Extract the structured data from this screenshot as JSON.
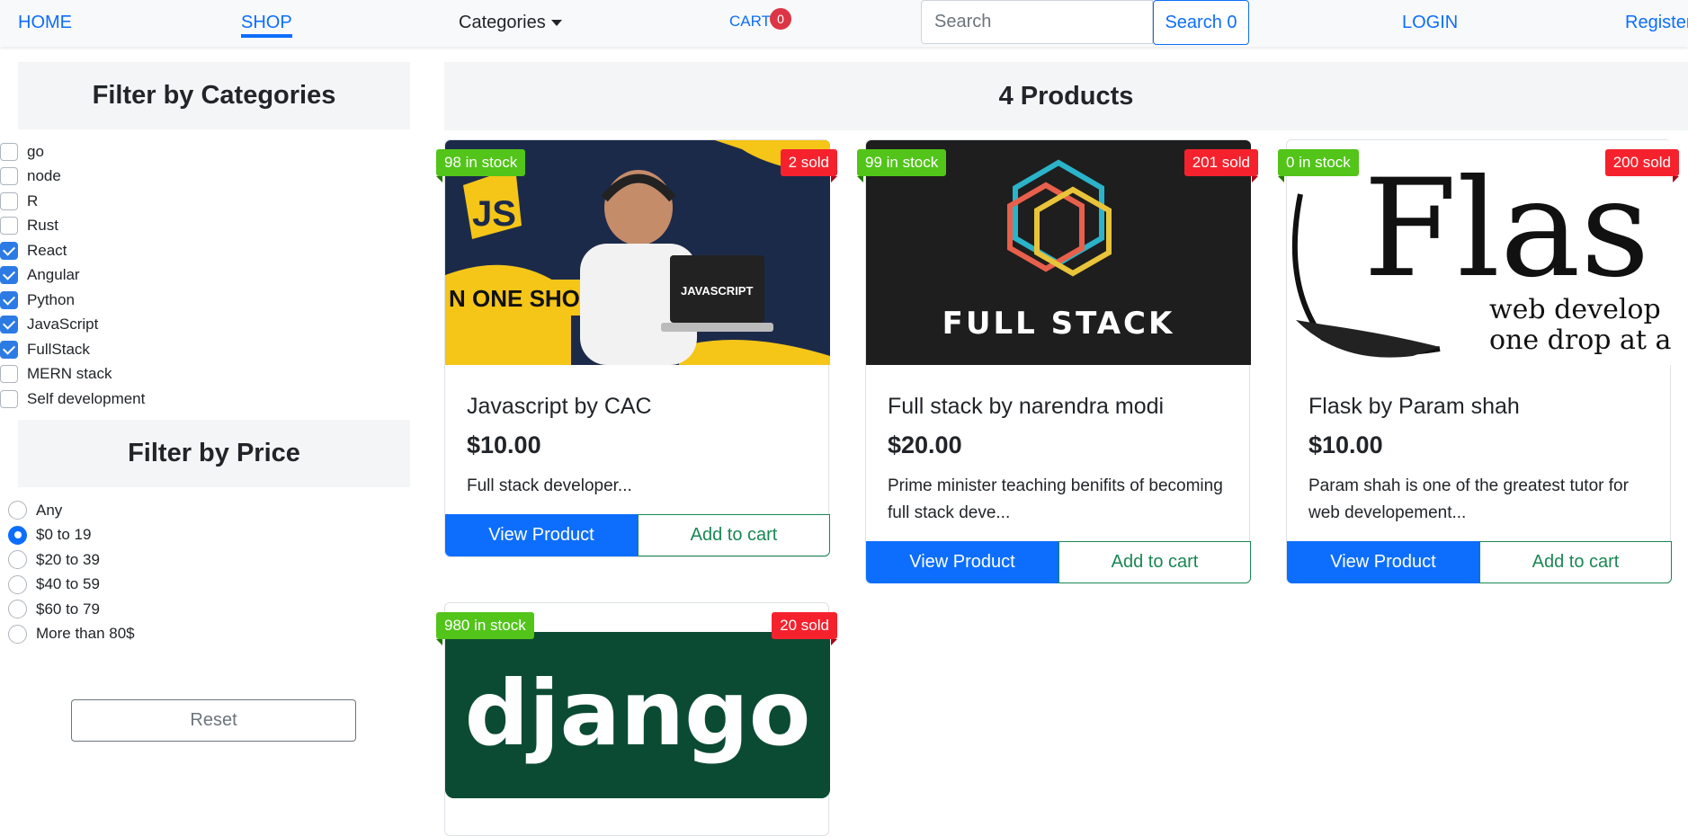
{
  "nav": {
    "home": "HOME",
    "shop": "SHOP",
    "categories": "Categories",
    "cart": "CART",
    "cart_count": "0",
    "search_placeholder": "Search",
    "search_button": "Search 0",
    "login": "LOGIN",
    "register": "Register"
  },
  "sidebar": {
    "category_title": "Filter by Categories",
    "categories": [
      {
        "label": "go",
        "checked": false
      },
      {
        "label": "node",
        "checked": false
      },
      {
        "label": "R",
        "checked": false
      },
      {
        "label": "Rust",
        "checked": false
      },
      {
        "label": "React",
        "checked": true
      },
      {
        "label": "Angular",
        "checked": true
      },
      {
        "label": "Python",
        "checked": true
      },
      {
        "label": "JavaScript",
        "checked": true
      },
      {
        "label": "FullStack",
        "checked": true
      },
      {
        "label": "MERN stack",
        "checked": false
      },
      {
        "label": "Self development",
        "checked": false
      }
    ],
    "price_title": "Filter by Price",
    "prices": [
      {
        "label": "Any",
        "checked": false
      },
      {
        "label": "$0 to 19",
        "checked": true
      },
      {
        "label": "$20 to 39",
        "checked": false
      },
      {
        "label": "$40 to 59",
        "checked": false
      },
      {
        "label": "$60 to 79",
        "checked": false
      },
      {
        "label": "More than 80$",
        "checked": false
      }
    ],
    "reset": "Reset"
  },
  "main": {
    "header": "4 Products",
    "products": [
      {
        "title": "Javascript by CAC",
        "price": "$10.00",
        "desc": "Full stack developer...",
        "stock": "98 in stock",
        "sold": "2 sold",
        "view": "View Product",
        "add": "Add to cart",
        "image_overlay": "N ONE SHOT",
        "image_badge": "JS",
        "laptop_text": "JAVASCRIPT"
      },
      {
        "title": "Full stack by narendra modi",
        "price": "$20.00",
        "desc": "Prime minister teaching benifits of becoming full stack deve...",
        "stock": "99 in stock",
        "sold": "201 sold",
        "view": "View Product",
        "add": "Add to cart",
        "image_text": "FULL STACK"
      },
      {
        "title": "Flask by Param shah",
        "price": "$10.00",
        "desc": "Param shah is one of the greatest tutor for web developement...",
        "stock": "0 in stock",
        "sold": "200 sold",
        "view": "View Product",
        "add": "Add to cart",
        "image_text": "Flas",
        "image_sub1": "web develop",
        "image_sub2": "one drop at a"
      },
      {
        "stock": "980 in stock",
        "sold": "20 sold",
        "image_text": "django"
      }
    ]
  },
  "colors": {
    "primary": "#0d6efd",
    "success": "#198754",
    "stock_ribbon": "#52c41a",
    "sold_ribbon": "#f5222d",
    "badge": "#dc3545"
  }
}
